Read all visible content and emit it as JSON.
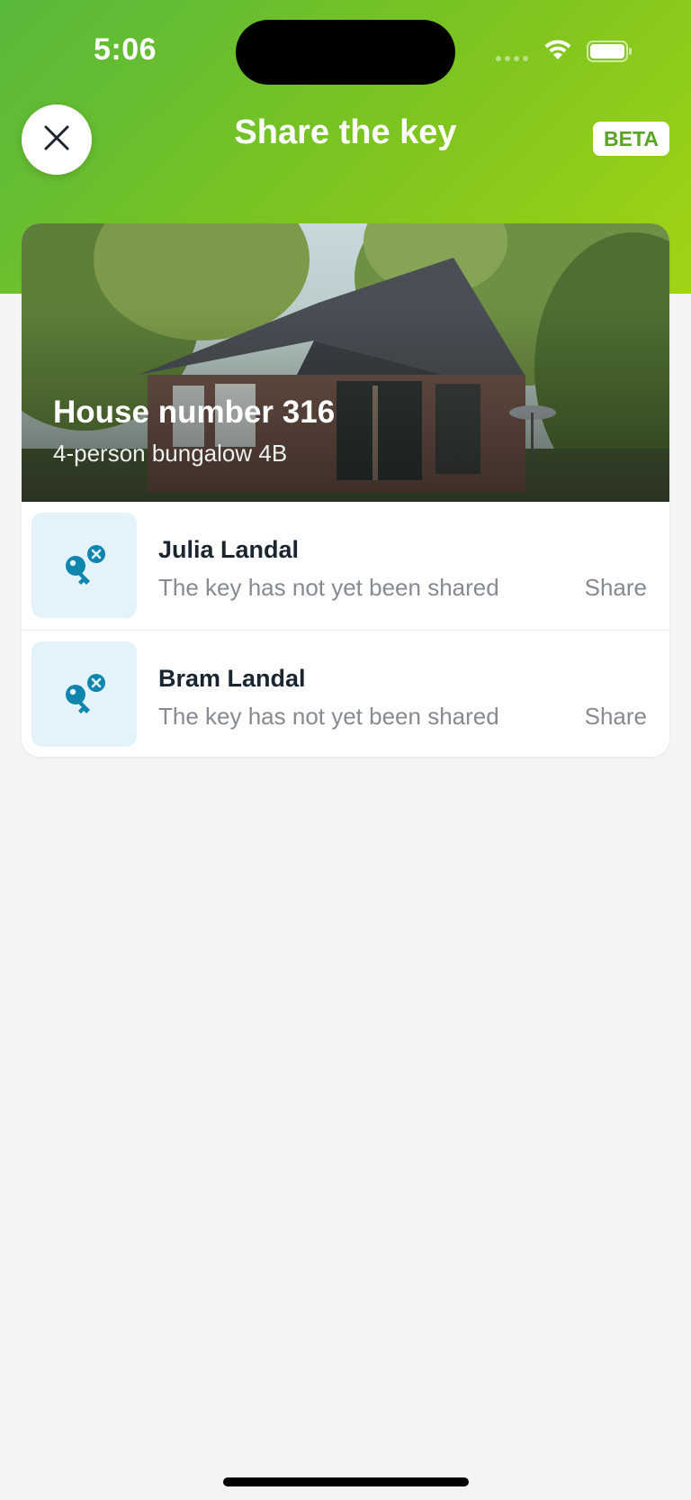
{
  "status_bar": {
    "time": "5:06"
  },
  "header": {
    "title": "Share the key",
    "badge": "BETA",
    "close_icon": "close-icon"
  },
  "property": {
    "title": "House number 316",
    "subtitle": "4-person bungalow 4B"
  },
  "recipients": [
    {
      "name": "Julia Landal",
      "status": "The key has not yet been shared",
      "action": "Share",
      "icon": "key-unshared-icon"
    },
    {
      "name": "Bram Landal",
      "status": "The key has not yet been shared",
      "action": "Share",
      "icon": "key-unshared-icon"
    }
  ],
  "colors": {
    "header_gradient_start": "#57b83c",
    "header_gradient_end": "#a2d315",
    "key_icon": "#0f86b0",
    "icon_bg": "#e4f3fa",
    "badge_text": "#5aa426"
  }
}
